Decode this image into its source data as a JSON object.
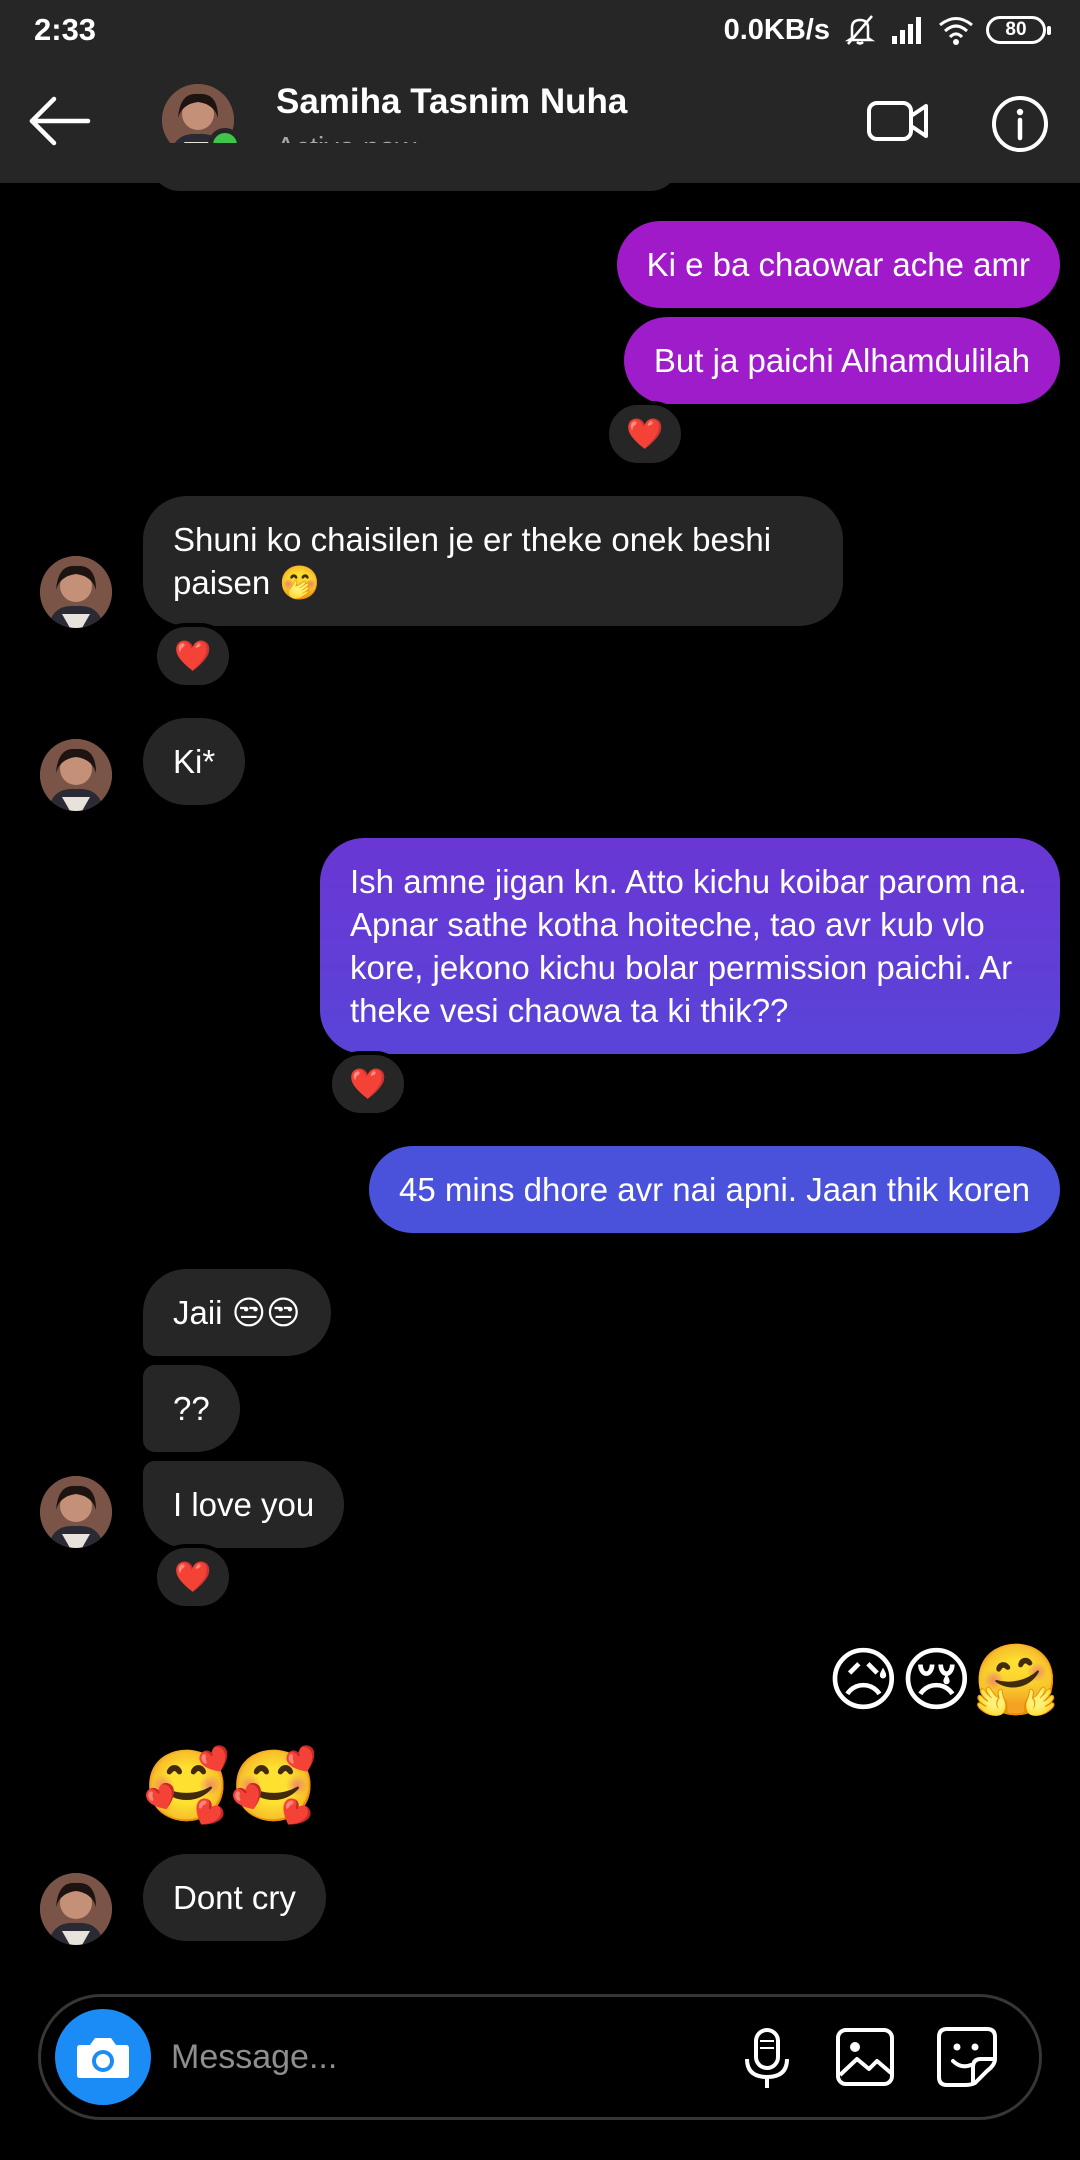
{
  "status_bar": {
    "time": "2:33",
    "speed": "0.0KB/s",
    "battery": "80"
  },
  "header": {
    "name": "Samiha Tasnim Nuha",
    "status": "Active now"
  },
  "messages": [
    {
      "side": "out",
      "text": "Ki e ba chaowar ache amr"
    },
    {
      "side": "out",
      "text": "But ja paichi Alhamdulilah",
      "reaction": "❤️"
    },
    {
      "side": "in",
      "text": "Shuni ko chaisilen je er theke onek beshi paisen 🤭",
      "reaction": "❤️"
    },
    {
      "side": "in",
      "text": "Ki*"
    },
    {
      "side": "out",
      "text": "Ish amne jigan kn. Atto kichu koibar parom na. Apnar sathe kotha hoiteche, tao avr kub vlo kore, jekono kichu bolar permission paichi. Ar theke vesi chaowa ta ki thik??",
      "reaction": "❤️"
    },
    {
      "side": "out",
      "text": "45 mins dhore avr nai apni. Jaan thik koren"
    },
    {
      "side": "in",
      "text": "Jaii 😒😒"
    },
    {
      "side": "in",
      "text": "??"
    },
    {
      "side": "in",
      "text": "I love you",
      "reaction": "❤️"
    },
    {
      "side": "out",
      "text": "😥😢🤗"
    },
    {
      "side": "in",
      "text": "🥰🥰"
    },
    {
      "side": "in",
      "text": "Dont cry"
    }
  ],
  "colors": {
    "out_gradient": [
      "#a01ac9",
      "#8e24c9",
      "#5e3fd6",
      "#4a52dc"
    ],
    "in_bubble": "#262626",
    "heart": "#e0303a",
    "camera_button": "#1b8cf5",
    "online": "#3ec54a"
  },
  "composer": {
    "placeholder": "Message..."
  }
}
